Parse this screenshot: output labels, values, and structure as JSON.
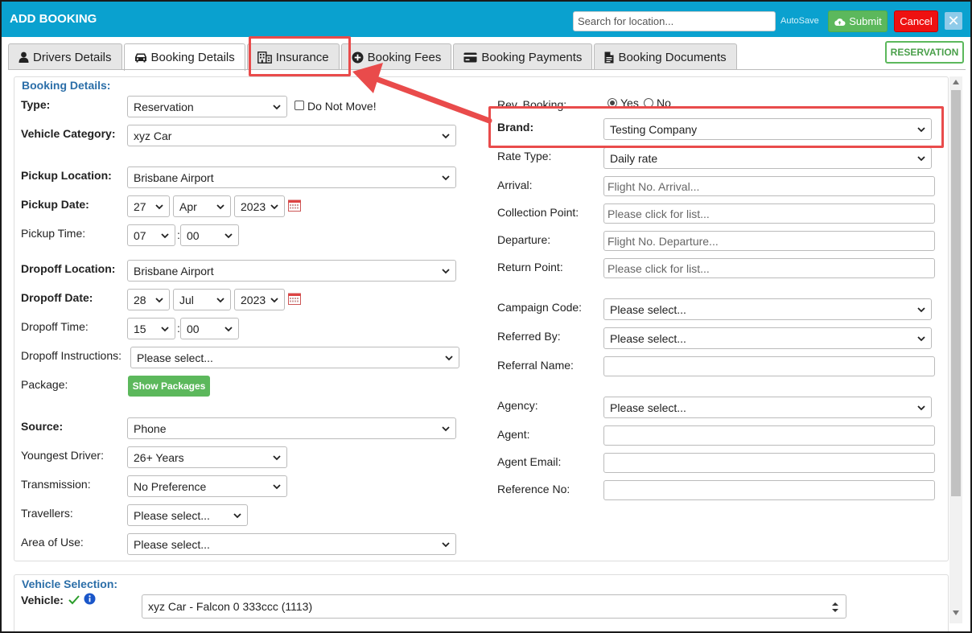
{
  "titlebar": {
    "title": "ADD BOOKING",
    "search_placeholder": "Search for location...",
    "autosave": "AutoSave",
    "submit": "Submit",
    "cancel": "Cancel",
    "close": "✕"
  },
  "tabs": [
    {
      "label": "Drivers Details",
      "icon": "user-icon"
    },
    {
      "label": "Booking Details",
      "icon": "car-icon"
    },
    {
      "label": "Insurance",
      "icon": "building-icon"
    },
    {
      "label": "Booking Fees",
      "icon": "plus-circle-icon"
    },
    {
      "label": "Booking Payments",
      "icon": "card-icon"
    },
    {
      "label": "Booking Documents",
      "icon": "file-icon"
    }
  ],
  "badge": "RESERVATION",
  "booking": {
    "section_title": "Booking Details:",
    "type": {
      "label": "Type:",
      "value": "Reservation"
    },
    "do_not_move": "Do Not Move!",
    "vehicle_category": {
      "label": "Vehicle Category:",
      "value": "xyz Car"
    },
    "pickup_location": {
      "label": "Pickup Location:",
      "value": "Brisbane Airport"
    },
    "pickup_date": {
      "label": "Pickup Date:",
      "day": "27",
      "month": "Apr",
      "year": "2023"
    },
    "pickup_time": {
      "label": "Pickup Time:",
      "hour": "07",
      "minute": "00"
    },
    "dropoff_location": {
      "label": "Dropoff Location:",
      "value": "Brisbane Airport"
    },
    "dropoff_date": {
      "label": "Dropoff Date:",
      "day": "28",
      "month": "Jul",
      "year": "2023"
    },
    "dropoff_time": {
      "label": "Dropoff Time:",
      "hour": "15",
      "minute": "00"
    },
    "dropoff_instructions": {
      "label": "Dropoff Instructions:",
      "value": "Please select..."
    },
    "package": {
      "label": "Package:",
      "button": "Show Packages"
    },
    "source": {
      "label": "Source:",
      "value": "Phone"
    },
    "youngest_driver": {
      "label": "Youngest Driver:",
      "value": "26+ Years"
    },
    "transmission": {
      "label": "Transmission:",
      "value": "No Preference"
    },
    "travellers": {
      "label": "Travellers:",
      "value": "Please select..."
    },
    "area_of_use": {
      "label": "Area of Use:",
      "value": "Please select..."
    },
    "rev_booking": {
      "label": "Rev. Booking:",
      "yes": "Yes",
      "no": "No"
    },
    "brand": {
      "label": "Brand:",
      "value": "Testing Company"
    },
    "rate_type": {
      "label": "Rate Type:",
      "value": "Daily rate"
    },
    "arrival": {
      "label": "Arrival:",
      "placeholder": "Flight No. Arrival..."
    },
    "collection_point": {
      "label": "Collection Point:",
      "placeholder": "Please click for list..."
    },
    "departure": {
      "label": "Departure:",
      "placeholder": "Flight No. Departure..."
    },
    "return_point": {
      "label": "Return Point:",
      "placeholder": "Please click for list..."
    },
    "campaign_code": {
      "label": "Campaign Code:",
      "value": "Please select..."
    },
    "referred_by": {
      "label": "Referred By:",
      "value": "Please select..."
    },
    "referral_name": {
      "label": "Referral Name:",
      "value": ""
    },
    "agency": {
      "label": "Agency:",
      "value": "Please select..."
    },
    "agent": {
      "label": "Agent:",
      "value": ""
    },
    "agent_email": {
      "label": "Agent Email:",
      "value": ""
    },
    "reference_no": {
      "label": "Reference No:",
      "value": ""
    }
  },
  "vehicle_selection": {
    "section_title": "Vehicle Selection:",
    "label": "Vehicle:",
    "value": "xyz Car - Falcon 0 333ccc (1113)"
  },
  "colors": {
    "titlebar": "#0aa1cf",
    "submit": "#5cb85c",
    "cancel": "#ee1111",
    "highlight": "#e94b4b",
    "section_title": "#2b6ea8"
  }
}
